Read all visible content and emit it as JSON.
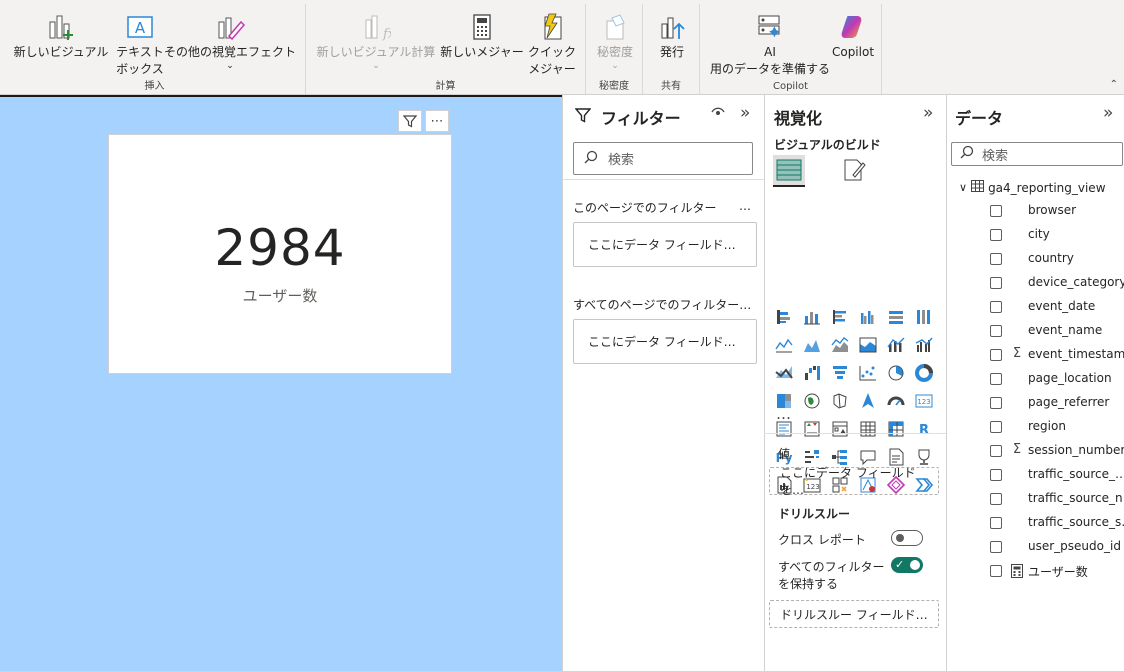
{
  "ribbon": {
    "insert": {
      "group_label": "挿入",
      "new_visual": "新しいビジュアル",
      "text_box_1": "テキスト",
      "text_box_2": "ボックス",
      "more_visuals": "その他の視覚エフェクト"
    },
    "calc": {
      "group_label": "計算",
      "new_visual_calc": "新しいビジュアル計算",
      "new_measure": "新しいメジャー",
      "quick_1": "クイック",
      "quick_2": "メジャー"
    },
    "sensitivity": {
      "group_label": "秘密度",
      "label": "秘密度"
    },
    "share": {
      "group_label": "共有",
      "publish": "発行"
    },
    "copilot": {
      "group_label": "Copilot",
      "ai_1": "AI",
      "ai_2": "用のデータを準備する",
      "copilot": "Copilot"
    }
  },
  "card": {
    "value": "2984",
    "label": "ユーザー数"
  },
  "filters": {
    "title": "フィルター",
    "search_placeholder": "検索",
    "page_filters": "このページでのフィルター",
    "page_filters_more": "…",
    "page_drop": "ここにデータ フィールド…",
    "all_pages_filters": "すべてのページでのフィルター…",
    "all_pages_drop": "ここにデータ フィールド…"
  },
  "viz": {
    "title": "視覚化",
    "build_label": "ビジュアルのビルド",
    "more": "…",
    "values_label": "値",
    "values_drop": "ここにデータ フィールドを…",
    "drill_label": "ドリルスルー",
    "cross_report": "クロス レポート",
    "keep_filters_1": "すべてのフィルター",
    "keep_filters_2": "を保持する",
    "drill_drop": "ドリルスルー フィールド…",
    "colors": {
      "accent": "#117865",
      "blue": "#2b88d8",
      "canvas": "#a6d2ff"
    }
  },
  "data": {
    "title": "データ",
    "search_placeholder": "検索",
    "table_name": "ga4_reporting_view",
    "fields": [
      {
        "name": "browser",
        "sigma": false
      },
      {
        "name": "city",
        "sigma": false
      },
      {
        "name": "country",
        "sigma": false
      },
      {
        "name": "device_category",
        "sigma": false
      },
      {
        "name": "event_date",
        "sigma": false
      },
      {
        "name": "event_name",
        "sigma": false
      },
      {
        "name": "event_timestamp",
        "sigma": true
      },
      {
        "name": "page_location",
        "sigma": false
      },
      {
        "name": "page_referrer",
        "sigma": false
      },
      {
        "name": "region",
        "sigma": false
      },
      {
        "name": "session_number",
        "sigma": true
      },
      {
        "name": "traffic_source_…",
        "sigma": false
      },
      {
        "name": "traffic_source_n…",
        "sigma": false
      },
      {
        "name": "traffic_source_s…",
        "sigma": false
      },
      {
        "name": "user_pseudo_id",
        "sigma": false
      },
      {
        "name": "ユーザー数",
        "sigma": false,
        "measure": true
      }
    ]
  }
}
